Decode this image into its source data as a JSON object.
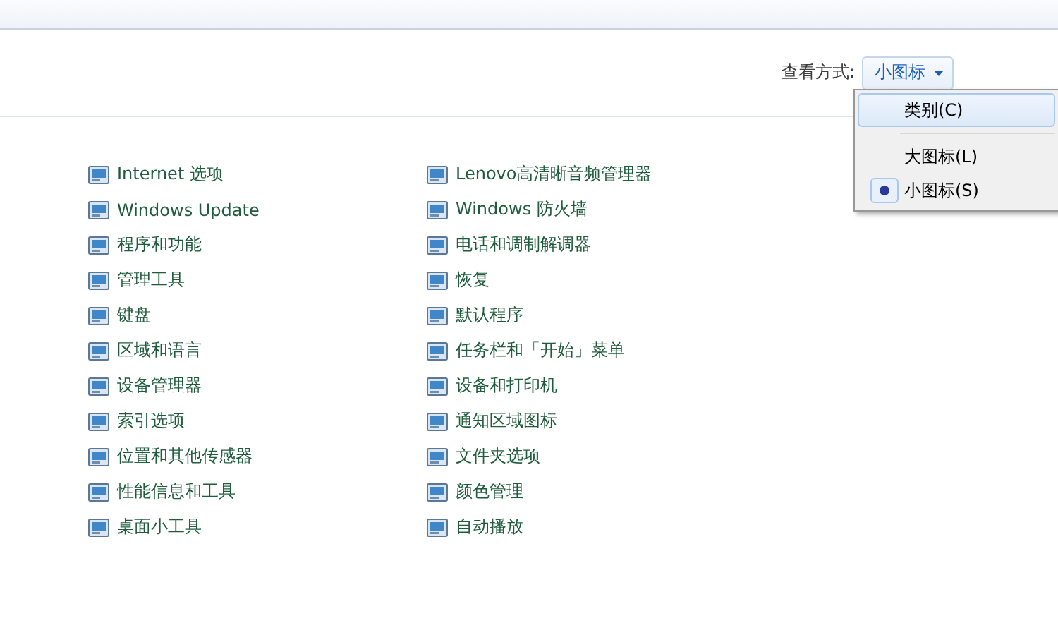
{
  "view": {
    "label": "查看方式:",
    "button": "小图标"
  },
  "view_menu": [
    {
      "kind": "item",
      "label": "类别(C)",
      "selected": false,
      "highlighted": true
    },
    {
      "kind": "separator"
    },
    {
      "kind": "item",
      "label": "大图标(L)",
      "selected": false,
      "highlighted": false
    },
    {
      "kind": "item",
      "label": "小图标(S)",
      "selected": true,
      "highlighted": false
    }
  ],
  "columns": [
    [
      "Internet 选项",
      "Windows Update",
      "程序和功能",
      "管理工具",
      "键盘",
      "区域和语言",
      "设备管理器",
      "索引选项",
      "位置和其他传感器",
      "性能信息和工具",
      "桌面小工具"
    ],
    [
      "Lenovo高清晰音频管理器",
      "Windows 防火墙",
      "电话和调制解调器",
      "恢复",
      "默认程序",
      "任务栏和「开始」菜单",
      "设备和打印机",
      "通知区域图标",
      "文件夹选项",
      "颜色管理",
      "自动播放"
    ]
  ]
}
